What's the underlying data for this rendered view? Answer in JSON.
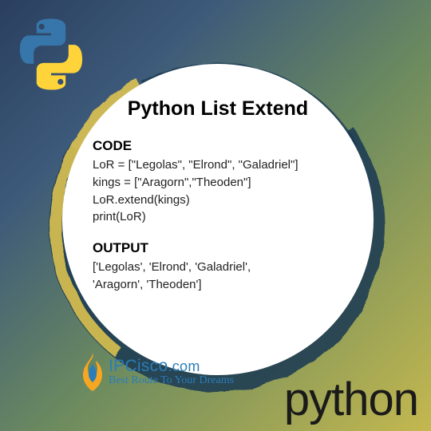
{
  "title": "Python List Extend",
  "code": {
    "label": "CODE",
    "lines": [
      "LoR = [\"Legolas\", \"Elrond\", \"Galadriel\"]",
      "kings = [\"Aragorn\",\"Theoden\"]",
      "LoR.extend(kings)",
      "print(LoR)"
    ]
  },
  "output": {
    "label": "OUTPUT",
    "lines": [
      "['Legolas', 'Elrond', 'Galadriel',",
      "'Aragorn', 'Theoden']"
    ]
  },
  "branding": {
    "site": "IPCisco",
    "domain": ".com",
    "tagline": "Best Route To Your Dreams"
  },
  "footer_word": "python"
}
